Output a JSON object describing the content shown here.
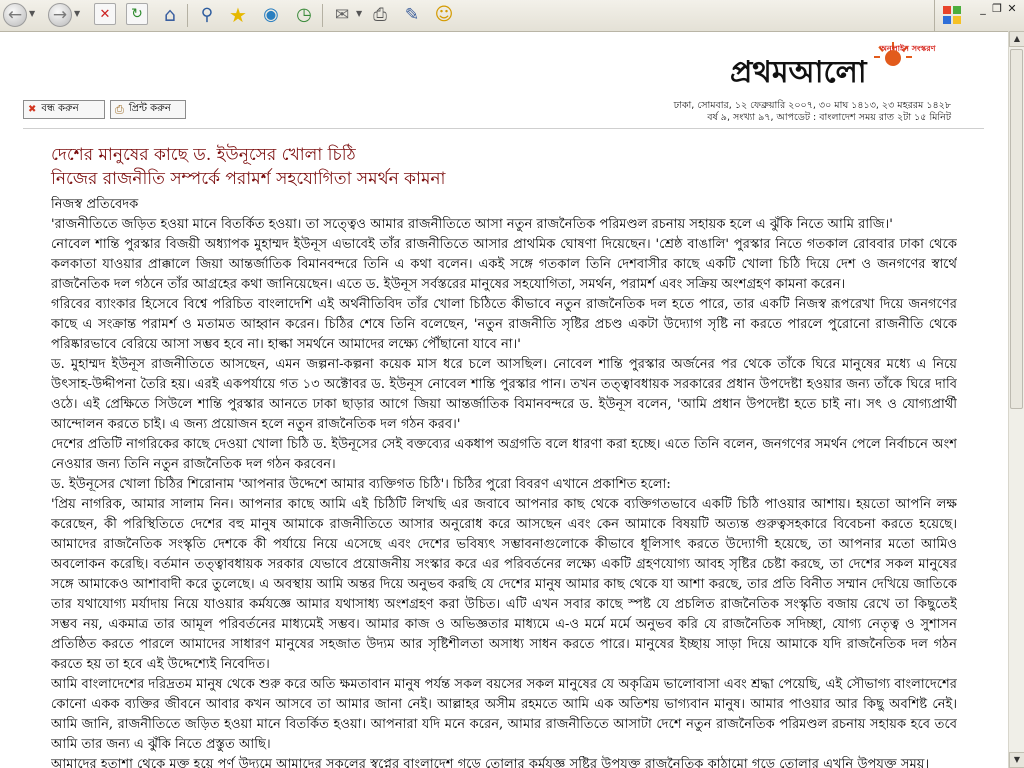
{
  "toolbar": {
    "icons": [
      "back-icon",
      "forward-icon",
      "stop-icon",
      "refresh-icon",
      "home-icon",
      "search-icon",
      "favorites-icon",
      "media-icon",
      "history-icon",
      "mail-icon",
      "print-icon",
      "edit-icon",
      "messenger-icon"
    ]
  },
  "window_controls": {
    "minimize": "_",
    "restore": "❐",
    "close": "✕"
  },
  "site": {
    "logo_text": "প্রথমআলো",
    "logo_tagline": "অনলাইন সংস্করণ",
    "accent_color": "#e25b1c"
  },
  "buttons": {
    "close_label": "বন্ধ করুন",
    "print_label": "প্রিন্ট করুন"
  },
  "dateline": {
    "line1": "ঢাকা, সোমবার, ১২ ফেব্রুয়ারি ২০০৭, ৩০ মাঘ ১৪১৩, ২৩ মহররম ১৪২৮",
    "line2": "বর্ষ ৯, সংখ্যা ৯৭, আপডেট : বাংলাদেশ সময় রাত ২টা ১৫ মিনিট"
  },
  "article": {
    "headline1": "দেশের মানুষের কাছে ড. ইউনূসের খোলা চিঠি",
    "headline2": "নিজের রাজনীতি সম্পর্কে পরামর্শ সহযোগিতা সমর্থন কামনা",
    "byline": "নিজস্ব প্রতিবেদক",
    "paragraphs": [
      "'রাজনীতিতে জড়িত হওয়া মানে বিতর্কিত হওয়া। তা সত্ত্বেও আমার রাজনীতিতে আসা নতুন রাজনৈতিক পরিমণ্ডল রচনায় সহায়ক হলে এ ঝুঁকি নিতে আমি রাজি।'",
      "নোবেল শান্তি পুরস্কার বিজয়ী অধ্যাপক মুহাম্মদ ইউনূস এভাবেই তাঁর রাজনীতিতে আসার প্রাথমিক ঘোষণা দিয়েছেন। 'শ্রেষ্ঠ বাঙালি' পুরস্কার নিতে গতকাল রোববার ঢাকা থেকে কলকাতা যাওয়ার প্রাক্কালে জিয়া আন্তর্জাতিক বিমানবন্দরে তিনি এ কথা বলেন। একই সঙ্গে গতকাল তিনি দেশবাসীর কাছে একটি খোলা চিঠি দিয়ে দেশ ও জনগণের স্বার্থে রাজনৈতিক দল গঠনে তাঁর আগ্রহের কথা জানিয়েছেন। এতে ড. ইউনূস সর্বস্তরের মানুষের সহযোগিতা, সমর্থন, পরামর্শ এবং সক্রিয় অংশগ্রহণ কামনা করেন।",
      "গরিবের ব্যাংকার হিসেবে বিশ্বে পরিচিত বাংলাদেশি এই অর্থনীতিবিদ তাঁর খোলা চিঠিতে কীভাবে নতুন রাজনৈতিক দল হতে পারে, তার একটি নিজস্ব রূপরেখা দিয়ে জনগণের কাছে এ সংক্রান্ত পরামর্শ ও মতামত আহ্বান করেন। চিঠির শেষে তিনি বলেছেন, 'নতুন রাজনীতি সৃষ্টির প্রচণ্ড একটা উদ্যোগ সৃষ্টি না করতে পারলে পুরোনো রাজনীতি থেকে পরিষ্কারভাবে বেরিয়ে আসা সম্ভব হবে না। হাল্কা সমর্থনে আমাদের লক্ষ্যে পৌঁছানো যাবে না।'",
      "ড. মুহাম্মদ ইউনূস রাজনীতিতে আসছেন, এমন জল্পনা-কল্পনা কয়েক মাস ধরে চলে আসছিল। নোবেল শান্তি পুরস্কার অর্জনের পর থেকে তাঁকে ঘিরে মানুষের মধ্যে এ নিয়ে উৎসাহ-উদ্দীপনা তৈরি হয়। এরই একপর্যায়ে গত ১৩ অক্টোবর ড. ইউনূস নোবেল শান্তি পুরস্কার পান। তখন তত্ত্বাবধায়ক সরকারের প্রধান উপদেষ্টা হওয়ার জন্য তাঁকে ঘিরে দাবি ওঠে। এই প্রেক্ষিতে সিউলে শান্তি পুরস্কার আনতে ঢাকা ছাড়ার আগে জিয়া আন্তর্জাতিক বিমানবন্দরে ড. ইউনূস বলেন, 'আমি প্রধান উপদেষ্টা হতে চাই না। সৎ ও যোগ্যপ্রার্থী আন্দোলন করতে চাই। এ জন্য প্রয়োজন হলে নতুন রাজনৈতিক দল গঠন করব।'",
      "দেশের প্রতিটি নাগরিকের কাছে দেওয়া খোলা চিঠি ড. ইউনূসের সেই বক্তব্যের একধাপ অগ্রগতি বলে ধারণা করা হচ্ছে। এতে তিনি বলেন, জনগণের সমর্থন পেলে নির্বাচনে অংশ নেওয়ার জন্য তিনি নতুন রাজনৈতিক দল গঠন করবেন।",
      "ড. ইউনূসের খোলা চিঠির শিরোনাম 'আপনার উদ্দেশে আমার ব্যক্তিগত চিঠি'। চিঠির পুরো বিবরণ এখানে প্রকাশিত হলো:",
      "'প্রিয় নাগরিক, আমার সালাম নিন। আপনার কাছে আমি এই চিঠিটি লিখছি এর জবাবে আপনার কাছ থেকে ব্যক্তিগতভাবে একটি চিঠি পাওয়ার আশায়। হয়তো আপনি লক্ষ করেছেন, কী পরিস্থিতিতে দেশের বহু মানুষ আমাকে রাজনীতিতে আসার অনুরোধ করে আসছেন এবং কেন আমাকে বিষয়টি অত্যন্ত গুরুত্বসহকারে বিবেচনা করতে হয়েছে। আমাদের রাজনৈতিক সংস্কৃতি দেশকে কী পর্যায়ে নিয়ে এসেছে এবং দেশের ভবিষ্যৎ সম্ভাবনাগুলোকে কীভাবে ধূলিসাৎ করতে উদ্যোগী হয়েছে, তা আপনার মতো আমিও অবলোকন করেছি। বর্তমান তত্ত্বাবধায়ক সরকার যেভাবে প্রয়োজনীয় সংস্কার করে এর পরিবর্তনের লক্ষ্যে একটি গ্রহণযোগ্য আবহ সৃষ্টির চেষ্টা করছে, তা দেশের সকল মানুষের সঙ্গে আমাকেও আশাবাদী করে তুলেছে। এ অবস্থায় আমি অন্তর দিয়ে অনুভব করছি যে দেশের মানুষ আমার কাছ থেকে যা আশা করছে, তার প্রতি বিনীত সম্মান দেখিয়ে জাতিকে তার যথাযোগ্য মর্যাদায় নিয়ে যাওয়ার কর্মযজ্ঞে আমার যথাসাধ্য অংশগ্রহণ করা উচিত। এটি এখন সবার কাছে স্পষ্ট যে প্রচলিত রাজনৈতিক সংস্কৃতি বজায় রেখে তা কিছুতেই সম্ভব নয়, একমাত্র তার আমূল পরিবর্তনের মাধ্যমেই সম্ভব। আমার কাজ ও অভিজ্ঞতার মাধ্যমে এ-ও মর্মে মর্মে অনুভব করি যে রাজনৈতিক সদিচ্ছা, যোগ্য নেতৃত্ব ও সুশাসন প্রতিষ্ঠিত করতে পারলে আমাদের সাধারণ মানুষের সহজাত উদ্যম আর সৃষ্টিশীলতা অসাধ্য সাধন করতে পারে। মানুষের ইচ্ছায় সাড়া দিয়ে আমাকে যদি রাজনৈতিক দল গঠন করতে হয় তা হবে এই উদ্দেশ্যেই নিবেদিত।",
      "আমি বাংলাদেশের দরিদ্রতম মানুষ থেকে শুরু করে অতি ক্ষমতাবান মানুষ পর্যন্ত সকল বয়সের সকল মানুষের যে অকৃত্রিম ভালোবাসা এবং শ্রদ্ধা পেয়েছি, এই সৌভাগ্য বাংলাদেশের কোনো একক ব্যক্তির জীবনে আবার কখন আসবে তা আমার জানা নেই। আল্লাহর অসীম রহমতে আমি এক অতিশয় ভাগ্যবান মানুষ। আমার পাওয়ার আর কিছু অবশিষ্ট নেই। আমি জানি, রাজনীতিতে জড়িত হওয়া মানে বিতর্কিত হওয়া। আপনারা যদি মনে করেন, আমার রাজনীতিতে আসাটা দেশে নতুন রাজনৈতিক পরিমণ্ডল রচনায় সহায়ক হবে তবে আমি তার জন্য এ ঝুঁকি নিতে প্রস্তুত আছি।",
      "আমাদের হতাশা থেকে মুক্ত হয়ে পূর্ণ উদ্যমে আমাদের সকলের স্বপ্নের বাংলাদেশ গড়ে তোলার কর্মযজ্ঞ সৃষ্টির উপযুক্ত রাজনৈতিক কাঠামো গড়ে তোলার এখনি উপযুক্ত সময়।"
    ]
  }
}
